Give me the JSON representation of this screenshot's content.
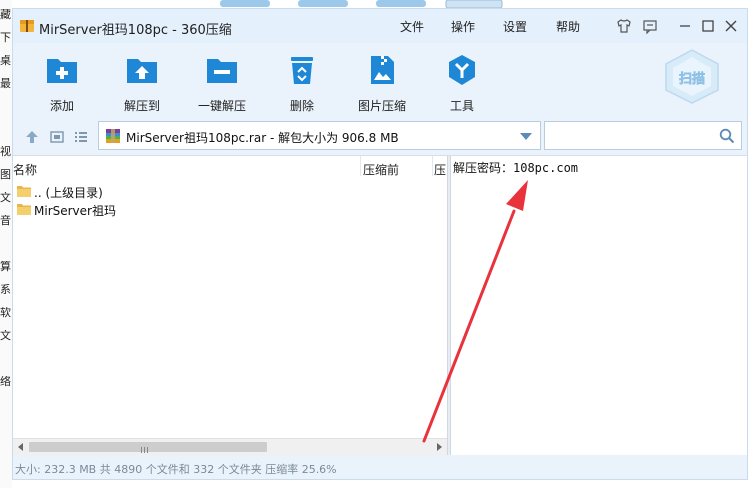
{
  "window": {
    "title": "MirServer祖玛108pc - 360压缩"
  },
  "menu": [
    {
      "label": "文件"
    },
    {
      "label": "操作"
    },
    {
      "label": "设置"
    },
    {
      "label": "帮助"
    }
  ],
  "toolbar": [
    {
      "label": "添加",
      "icon": "add-folder-icon"
    },
    {
      "label": "解压到",
      "icon": "extract-to-icon"
    },
    {
      "label": "一键解压",
      "icon": "one-click-extract-icon"
    },
    {
      "label": "删除",
      "icon": "recycle-bin-icon"
    },
    {
      "label": "图片压缩",
      "icon": "image-compress-icon"
    },
    {
      "label": "工具",
      "icon": "tools-icon"
    }
  ],
  "scan": {
    "label": "扫描"
  },
  "address": {
    "path": "MirServer祖玛108pc.rar - 解包大小为 906.8 MB"
  },
  "search": {
    "value": "",
    "placeholder": ""
  },
  "columns": [
    {
      "label": "名称"
    },
    {
      "label": "压缩前"
    },
    {
      "label": "压"
    }
  ],
  "files": [
    {
      "name": ".. (上级目录)"
    },
    {
      "name": "MirServer祖玛"
    }
  ],
  "note": {
    "text": "解压密码：108pc.com"
  },
  "status": {
    "text": "大小: 232.3 MB 共 4890 个文件和 332 个文件夹 压缩率 25.6%"
  },
  "background_left_chars": [
    "藏",
    "下",
    "桌",
    "最",
    "视",
    "图",
    "文",
    "音",
    "算",
    "系",
    "软",
    "文",
    "络"
  ],
  "colors": {
    "accent": "#1e88d6",
    "titlebar": "#e4f0fb",
    "annotation_arrow": "#e8323c"
  }
}
